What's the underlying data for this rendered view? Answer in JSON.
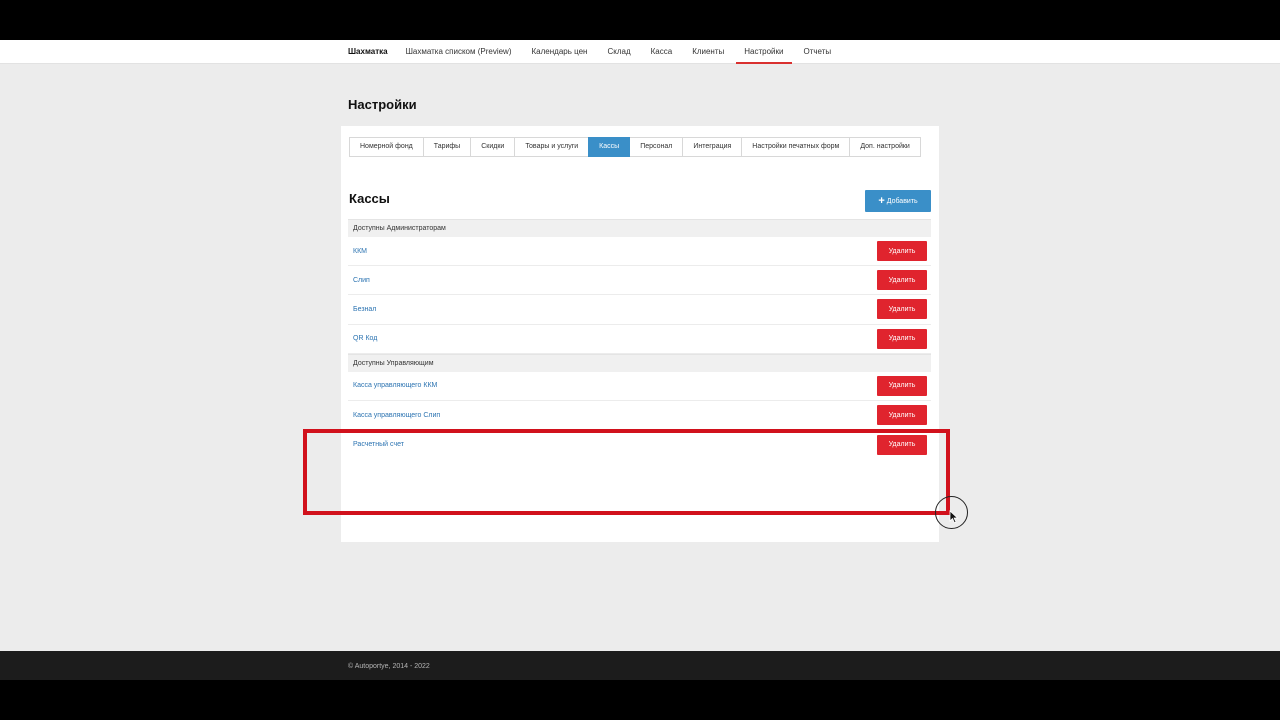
{
  "nav": {
    "brand": "Шахматка",
    "items": [
      {
        "label": "Шахматка списком (Preview)"
      },
      {
        "label": "Календарь цен"
      },
      {
        "label": "Склад"
      },
      {
        "label": "Касса"
      },
      {
        "label": "Клиенты"
      },
      {
        "label": "Настройки",
        "active": true
      },
      {
        "label": "Отчеты"
      }
    ]
  },
  "page_title": "Настройки",
  "tabs": [
    {
      "label": "Номерной фонд"
    },
    {
      "label": "Тарифы"
    },
    {
      "label": "Скидки"
    },
    {
      "label": "Товары и услуги"
    },
    {
      "label": "Кассы",
      "active": true
    },
    {
      "label": "Персонал"
    },
    {
      "label": "Интеграция"
    },
    {
      "label": "Настройки печатных форм"
    },
    {
      "label": "Доп. настройки"
    }
  ],
  "section": {
    "title": "Кассы",
    "add_label": "Добавить",
    "add_icon": "plus-icon"
  },
  "groups": [
    {
      "header": "Доступны Администраторам",
      "rows": [
        {
          "name": "ККМ",
          "action": "Удалить"
        },
        {
          "name": "Слип",
          "action": "Удалить"
        },
        {
          "name": "Безнал",
          "action": "Удалить"
        },
        {
          "name": "QR Код",
          "action": "Удалить"
        }
      ]
    },
    {
      "header": "Доступны Управляющим",
      "rows": [
        {
          "name": "Касса управляющего ККМ",
          "action": "Удалить"
        },
        {
          "name": "Касса управляющего Слип",
          "action": "Удалить"
        },
        {
          "name": "Расчетный счет",
          "action": "Удалить"
        }
      ]
    }
  ],
  "footer": {
    "copyright": "© Autoportye, 2014 - 2022"
  },
  "colors": {
    "accent_blue": "#3a8fc8",
    "danger_red": "#e0242e",
    "highlight_red": "#d1111c",
    "link_blue": "#2b73b1",
    "page_bg": "#ececec"
  }
}
